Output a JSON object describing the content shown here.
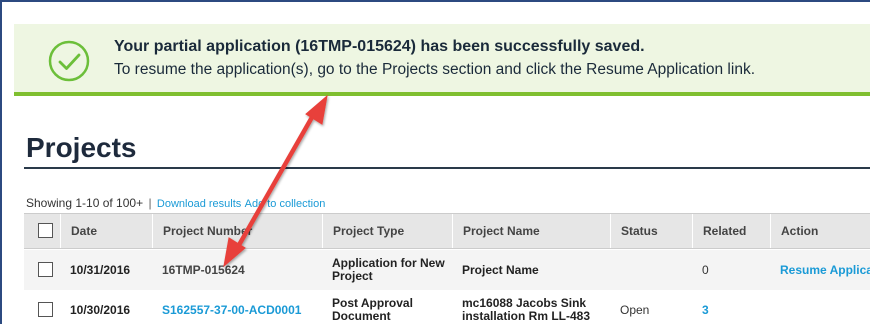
{
  "banner": {
    "title": "Your partial application (16TMP-015624) has been successfully saved.",
    "message": "To resume the application(s), go to the Projects section and click the Resume Application link."
  },
  "page": {
    "title": "Projects"
  },
  "results": {
    "showing": "Showing 1-10 of 100+",
    "separator": "|",
    "download_link": "Download results",
    "collection_link": "Add to collection"
  },
  "table": {
    "headers": [
      "Date",
      "Project Number",
      "Project Type",
      "Project Name",
      "Status",
      "Related",
      "Action"
    ],
    "rows": [
      {
        "date": "10/31/2016",
        "number": "16TMP-015624",
        "type_line1": "Application for New",
        "type_line2": "Project",
        "name_line1": "Project Name",
        "name_line2": "",
        "status": "",
        "related": "0",
        "action": "Resume Applica"
      },
      {
        "date": "10/30/2016",
        "number": "S162557-37-00-ACD0001",
        "type_line1": "Post Approval",
        "type_line2": "Document",
        "name_line1": "mc16088 Jacobs Sink",
        "name_line2": "installation Rm LL-483",
        "status": "Open",
        "related": "3",
        "action": ""
      }
    ]
  },
  "colors": {
    "banner_bg": "#eef6e2",
    "banner_border": "#7fbf2f",
    "link": "#1a9ad6",
    "arrow": "#e8403a"
  }
}
